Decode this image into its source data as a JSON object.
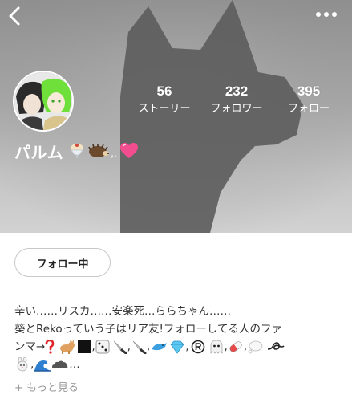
{
  "header": {
    "back_icon": "chevron-left-icon",
    "more_icon": "ellipsis-icon"
  },
  "profile": {
    "name": "パルム",
    "stats": [
      {
        "value": "56",
        "label": "ストーリー"
      },
      {
        "value": "232",
        "label": "フォロワー"
      },
      {
        "value": "395",
        "label": "フォロー"
      }
    ],
    "follow_button": "フォロー中",
    "bio_line1": "辛い……リスカ……安楽死…ららちゃん……",
    "bio_line2": " 葵とRekoっていう子はリア友!フォローしてる人のファ",
    "bio_line3_prefix": "ンマ→",
    "see_more": "+ もっと見る"
  },
  "colors": {
    "hero_top": "#8f8f8f",
    "hero_bottom": "#d2d2d2",
    "silhouette": "#5c5c5c",
    "heart": "#f24e8f",
    "text_main": "#333333",
    "text_muted": "#999999"
  }
}
